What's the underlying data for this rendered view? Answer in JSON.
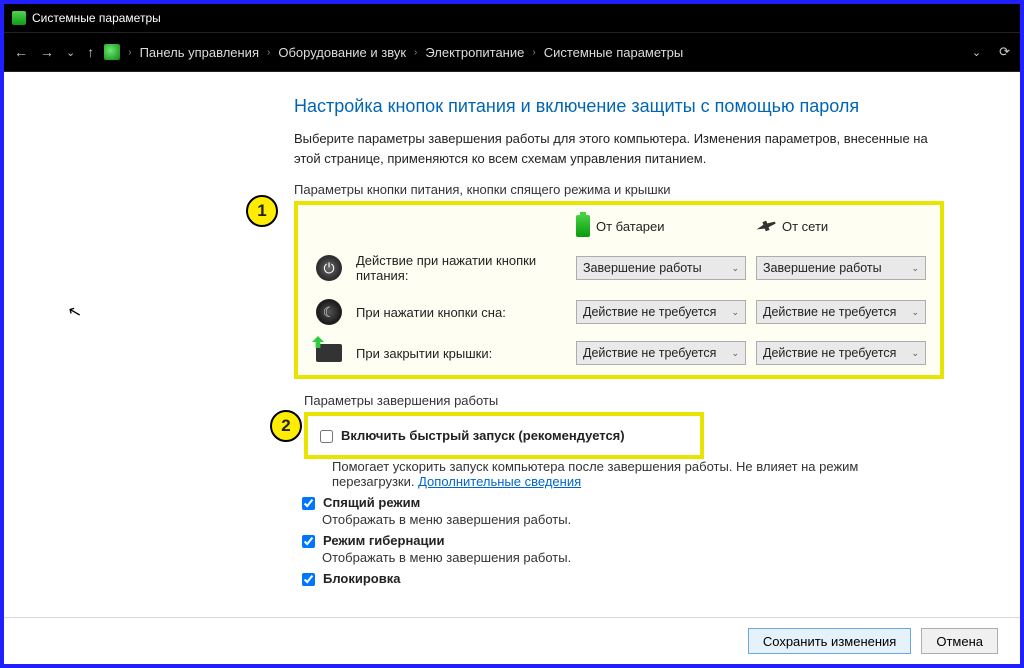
{
  "window": {
    "title": "Системные параметры"
  },
  "breadcrumb": {
    "items": [
      "Панель управления",
      "Оборудование и звук",
      "Электропитание",
      "Системные параметры"
    ]
  },
  "page": {
    "heading": "Настройка кнопок питания и включение защиты с помощью пароля",
    "description": "Выберите параметры завершения работы для этого компьютера. Изменения параметров, внесенные на этой странице, применяются ко всем схемам управления питанием.",
    "section1_label": "Параметры кнопки питания, кнопки спящего режима и крышки",
    "section2_label": "Параметры завершения работы"
  },
  "callouts": {
    "one": "1",
    "two": "2"
  },
  "columns": {
    "battery": "От батареи",
    "ac": "От сети"
  },
  "rows": {
    "power": {
      "label": "Действие при нажатии кнопки питания:",
      "battery": "Завершение работы",
      "ac": "Завершение работы"
    },
    "sleep": {
      "label": "При нажатии кнопки сна:",
      "battery": "Действие не требуется",
      "ac": "Действие не требуется"
    },
    "lid": {
      "label": "При закрытии крышки:",
      "battery": "Действие не требуется",
      "ac": "Действие не требуется"
    }
  },
  "shutdown": {
    "fast_start": {
      "label": "Включить быстрый запуск (рекомендуется)",
      "desc_prefix": "Помогает ускорить запуск компьютера после завершения работы. Не влияет на режим перезагрузки. ",
      "link": "Дополнительные сведения",
      "checked": false
    },
    "sleep_mode": {
      "label": "Спящий режим",
      "desc": "Отображать в меню завершения работы.",
      "checked": true
    },
    "hibernate": {
      "label": "Режим гибернации",
      "desc": "Отображать в меню завершения работы.",
      "checked": true
    },
    "lock": {
      "label": "Блокировка",
      "checked": true
    }
  },
  "footer": {
    "save": "Сохранить изменения",
    "cancel": "Отмена"
  }
}
